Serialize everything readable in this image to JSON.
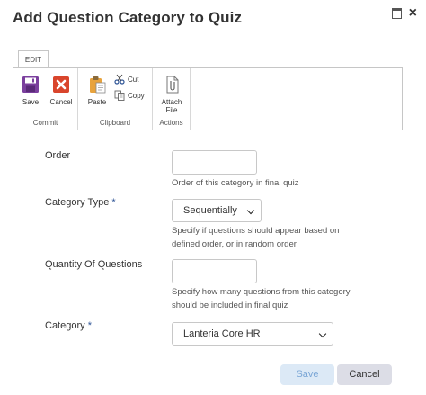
{
  "dialog": {
    "title": "Add Question Category to Quiz",
    "close_glyph": "×"
  },
  "ribbon": {
    "tab_label": "EDIT",
    "groups": {
      "commit": {
        "label": "Commit",
        "save": "Save",
        "cancel": "Cancel"
      },
      "clipboard": {
        "label": "Clipboard",
        "paste": "Paste",
        "cut": "Cut",
        "copy": "Copy"
      },
      "actions": {
        "label": "Actions",
        "attach_line1": "Attach",
        "attach_line2": "File"
      }
    }
  },
  "form": {
    "order": {
      "label": "Order",
      "value": "",
      "hint": "Order of this category in final quiz"
    },
    "category_type": {
      "label": "Category Type",
      "required_mark": "*",
      "selected": "Sequentially",
      "hint_line1": "Specify if questions should appear based on",
      "hint_line2": "defined order, or in random order"
    },
    "quantity": {
      "label": "Quantity Of Questions",
      "value": "",
      "hint_line1": "Specify how many questions from this category",
      "hint_line2": "should be included in final quiz"
    },
    "category": {
      "label": "Category",
      "required_mark": "*",
      "selected": "Lanteria Core HR"
    }
  },
  "footer": {
    "save": "Save",
    "cancel": "Cancel"
  },
  "colors": {
    "accent": "#2f5597",
    "save_purple": "#7b3f9e",
    "cancel_red": "#d9452c",
    "paste_orange": "#e8a33d"
  }
}
